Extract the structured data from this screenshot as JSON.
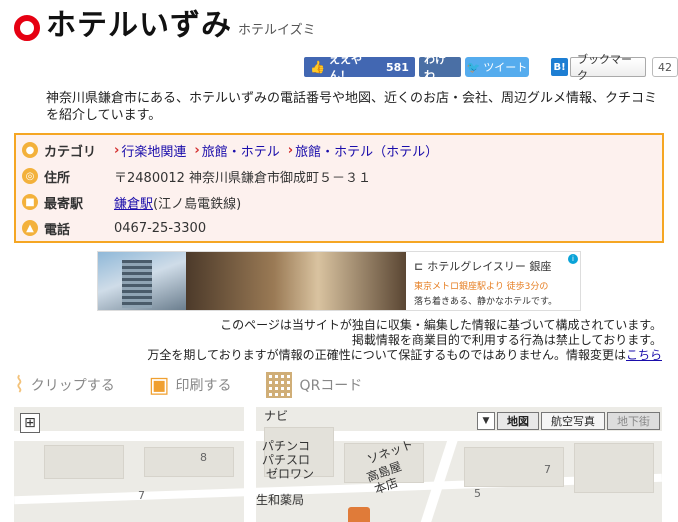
{
  "header": {
    "title": "ホテルいずみ",
    "kana": "ホテルイズミ"
  },
  "social": {
    "facebook_label": "ええやん！",
    "facebook_count": "581",
    "wakewaka_label": "わけわ",
    "tweet_label": "ツイート",
    "hatena_icon": "B!",
    "hatena_label": "ブックマーク",
    "hatena_count": "42"
  },
  "intro": "神奈川県鎌倉市にある、ホテルいずみの電話番号や地図、近くのお店・会社、周辺グルメ情報、クチコミを紹介しています。",
  "info": {
    "category_label": "カテゴリ",
    "categories": [
      "行楽地関連",
      "旅館・ホテル",
      "旅館・ホテル（ホテル）"
    ],
    "address_label": "住所",
    "address": "〒2480012 神奈川県鎌倉市御成町５－３１",
    "station_label": "最寄駅",
    "station_name": "鎌倉駅",
    "station_line": "(江ノ島電鉄線)",
    "phone_label": "電話",
    "phone": "0467-25-3300"
  },
  "ad": {
    "brand": "ホテルグレイスリー 銀座",
    "line2": "東京メトロ銀座駅より 徒歩3分の",
    "line3": "落ち着きある、静かなホテルです。"
  },
  "notice": {
    "line1": "このページは当サイトが独自に収集・編集した情報に基づいて構成されています。",
    "line2": "掲載情報を商業目的で利用する行為は禁止しております。",
    "line3": "万全を期しておりますが情報の正確性について保証するものではありません。情報変更は",
    "link": "こちら"
  },
  "tools": {
    "clip": "クリップする",
    "print": "印刷する",
    "qr": "QRコード"
  },
  "map": {
    "types": [
      "地図",
      "航空写真",
      "地下街"
    ],
    "labels": [
      "パチンコ",
      "パチスロ",
      "ゼロワン",
      "ソネット",
      "高島屋",
      "本店",
      "生和薬局",
      "ナビ"
    ],
    "numbers": [
      "8",
      "7",
      "5",
      "7"
    ]
  },
  "colors": {
    "accent": "#f5a623",
    "logo": "#e60012",
    "link": "#1a0dab"
  }
}
